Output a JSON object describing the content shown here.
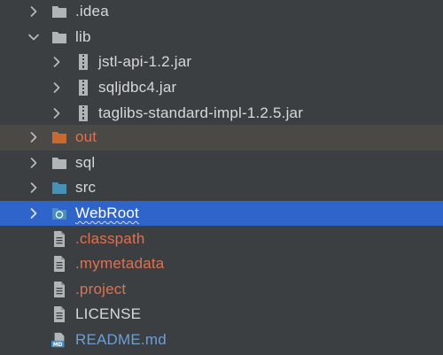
{
  "tree": {
    "rows": [
      {
        "label": ".idea",
        "icon": "folder-icon",
        "chevron": "chevron-right",
        "color": "normal"
      },
      {
        "label": "lib",
        "icon": "folder-icon",
        "chevron": "chevron-down",
        "color": "normal"
      },
      {
        "label": "jstl-api-1.2.jar",
        "icon": "jar-icon",
        "chevron": "chevron-right",
        "color": "normal"
      },
      {
        "label": "sqljdbc4.jar",
        "icon": "jar-icon",
        "chevron": "chevron-right",
        "color": "normal"
      },
      {
        "label": "taglibs-standard-impl-1.2.5.jar",
        "icon": "jar-icon",
        "chevron": "chevron-right",
        "color": "normal"
      },
      {
        "label": "out",
        "icon": "excluded-folder-icon",
        "chevron": "chevron-right",
        "color": "orange"
      },
      {
        "label": "sql",
        "icon": "folder-icon",
        "chevron": "chevron-right",
        "color": "normal"
      },
      {
        "label": "src",
        "icon": "source-folder-icon",
        "chevron": "chevron-right",
        "color": "normal"
      },
      {
        "label": "WebRoot",
        "icon": "web-folder-icon",
        "chevron": "chevron-right",
        "color": "white"
      },
      {
        "label": ".classpath",
        "icon": "file-icon",
        "chevron": "",
        "color": "orange"
      },
      {
        "label": ".mymetadata",
        "icon": "file-icon",
        "chevron": "",
        "color": "orange"
      },
      {
        "label": ".project",
        "icon": "file-icon",
        "chevron": "",
        "color": "orange"
      },
      {
        "label": "LICENSE",
        "icon": "file-icon",
        "chevron": "",
        "color": "normal"
      },
      {
        "label": "README.md",
        "icon": "markdown-file-icon",
        "chevron": "",
        "color": "blue"
      }
    ]
  },
  "colors": {
    "background": "#3c3f41",
    "selection": "#2f65ca",
    "excluded_row": "#4a4946",
    "folder": "#b0b5ba",
    "excluded_folder": "#c9682f",
    "source_folder": "#4a8fb5",
    "text": "#d6d9dc",
    "vcs_orange": "#e1704f",
    "vcs_blue": "#6a9fd8"
  },
  "icon_glyphs": {
    "markdown_badge": "MD"
  }
}
